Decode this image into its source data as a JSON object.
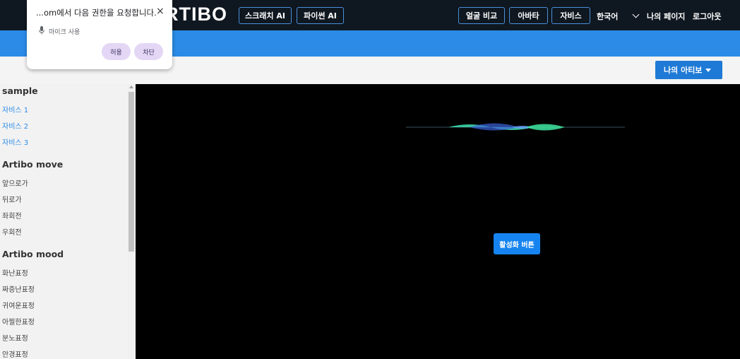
{
  "navbar": {
    "logo": "RTIBO",
    "scratch_ai": "스크래치 AI",
    "python_ai": "파이썬 AI",
    "face_compare": "얼굴 비교",
    "avatar": "아바타",
    "service": "자비스",
    "language": "한국어",
    "my_page": "나의 페이지",
    "logout": "로그아웃"
  },
  "toolbar": {
    "my_artibo": "나의 아티보"
  },
  "sidebar": {
    "sections": [
      {
        "title": "sample",
        "items": [
          "자비스 1",
          "자비스 2",
          "자비스 3"
        ]
      },
      {
        "title": "Artibo move",
        "items": [
          "앞으로가",
          "뒤로가",
          "좌회전",
          "우회전"
        ]
      },
      {
        "title": "Artibo mood",
        "items": [
          "화난표정",
          "짜증난표정",
          "귀여운표정",
          "아찔한표정",
          "분노표정",
          "안경표정"
        ]
      }
    ]
  },
  "main": {
    "activate_button": "활성화 버튼"
  },
  "permission_popup": {
    "title": "...om에서 다음 권한을 요청합니다.",
    "close": "×",
    "item": "마이크 사용",
    "allow": "허용",
    "block": "차단"
  },
  "colors": {
    "navbar_bg": "#0f1720",
    "accent_blue": "#2b8be6",
    "button_blue": "#1684f0",
    "popup_button_bg": "#e3d7f5"
  }
}
